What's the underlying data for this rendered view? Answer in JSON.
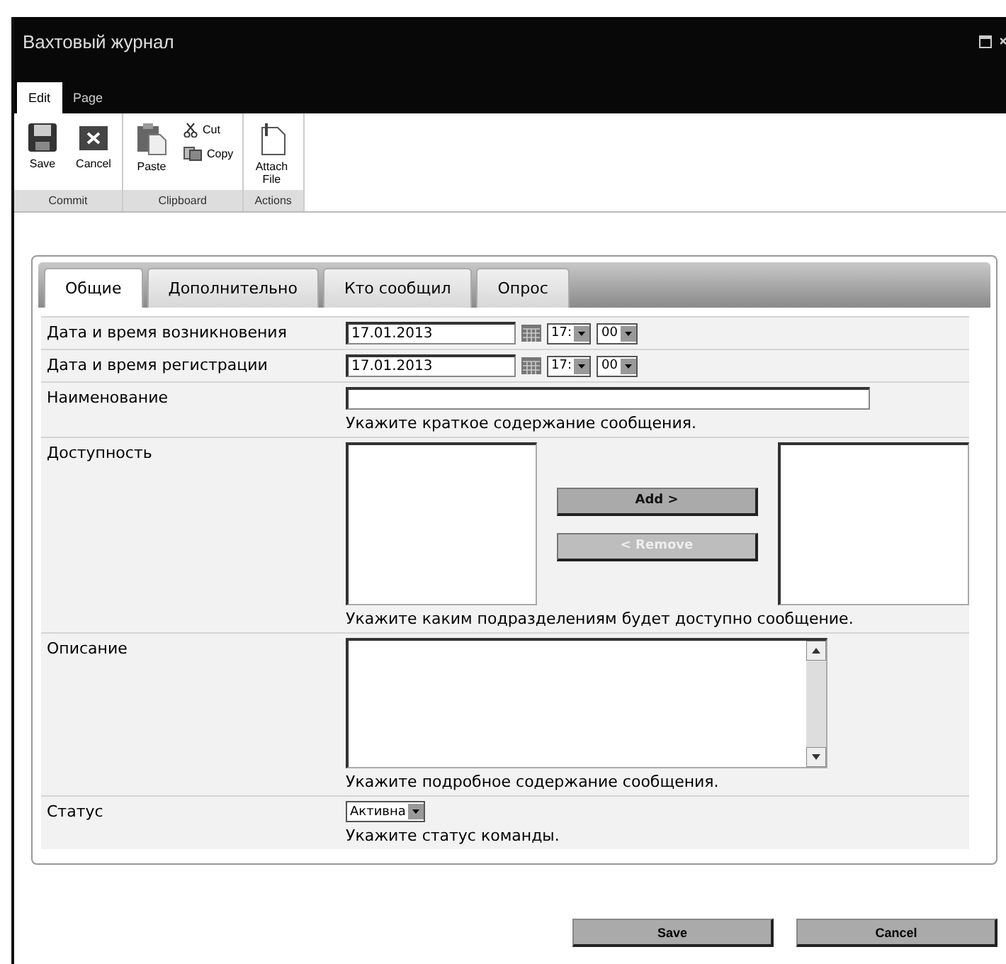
{
  "window": {
    "title": "Вахтовый журнал"
  },
  "ribbon_tabs": [
    {
      "label": "Edit",
      "selected": true
    },
    {
      "label": "Page",
      "selected": false
    }
  ],
  "ribbon_groups": [
    {
      "label": "Commit",
      "buttons": [
        {
          "kind": "save",
          "label": "Save"
        },
        {
          "kind": "cancel",
          "label": "Cancel"
        }
      ]
    },
    {
      "label": "Clipboard",
      "buttons": [
        {
          "kind": "paste",
          "label": "Paste"
        },
        {
          "kind": "cut",
          "label": "Cut"
        },
        {
          "kind": "copy",
          "label": "Copy"
        }
      ]
    },
    {
      "label": "Actions",
      "buttons": [
        {
          "kind": "attach",
          "label": "Attach File"
        }
      ]
    }
  ],
  "form_tabs": [
    {
      "label": "Общие",
      "selected": true
    },
    {
      "label": "Дополнительно",
      "selected": false
    },
    {
      "label": "Кто сообщил",
      "selected": false
    },
    {
      "label": "Опрос",
      "selected": false
    }
  ],
  "fields": [
    {
      "kind": "datetime",
      "label": "Дата и время возникновения",
      "date": "17.01.2013",
      "hour": "17:",
      "minute": "00"
    },
    {
      "kind": "datetime",
      "label": "Дата и время регистрации",
      "date": "17.01.2013",
      "hour": "17:",
      "minute": "00"
    },
    {
      "kind": "text",
      "label": "Наименование",
      "hint": "Укажите краткое содержание сообщения."
    },
    {
      "kind": "picker",
      "label": "Доступность",
      "add": "Add >",
      "remove": "< Remove",
      "remove_disabled": true,
      "hint": "Укажите каким подразделениям будет доступно сообщение."
    },
    {
      "kind": "textarea",
      "label": "Описание",
      "hint": "Укажите подробное содержание сообщения."
    },
    {
      "kind": "select",
      "label": "Статус",
      "value": "Активна",
      "hint": "Укажите статус команды."
    }
  ],
  "buttons": [
    "Save",
    "Cancel"
  ]
}
